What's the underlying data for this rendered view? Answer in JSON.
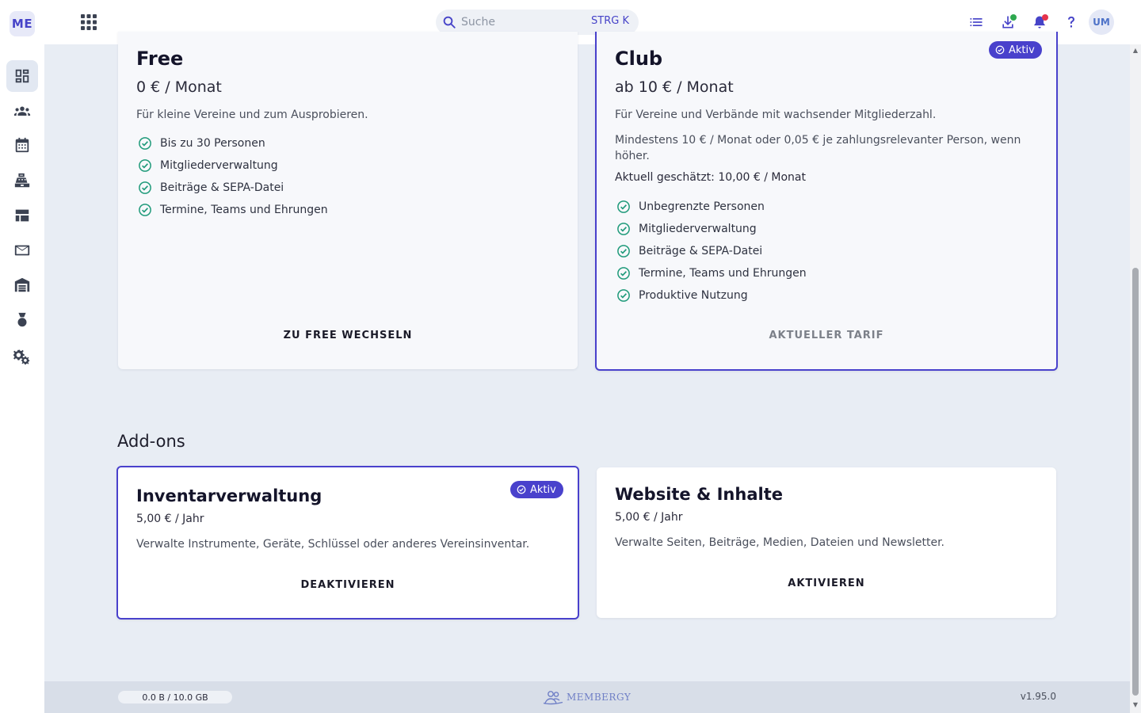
{
  "sidebar": {
    "logo": "ME",
    "items": [
      {
        "icon": "dashboard-icon",
        "active": true
      },
      {
        "icon": "people-icon"
      },
      {
        "icon": "calendar-icon"
      },
      {
        "icon": "cash-register-icon"
      },
      {
        "icon": "layout-icon"
      },
      {
        "icon": "mail-icon"
      },
      {
        "icon": "warehouse-icon"
      },
      {
        "icon": "medal-icon"
      },
      {
        "icon": "settings-icon"
      }
    ]
  },
  "header": {
    "search_placeholder": "Suche",
    "search_shortcut": "STRG K",
    "avatar_initials": "UM",
    "notification_dot_color": "#e5334b",
    "download_dot_color": "#2ea84f"
  },
  "plans": {
    "free": {
      "title": "Free",
      "price": "0 € / Monat",
      "description": "Für kleine Vereine und zum Ausprobieren.",
      "features": [
        "Bis zu 30 Personen",
        "Mitgliederverwaltung",
        "Beiträge & SEPA-Datei",
        "Termine, Teams und Ehrungen"
      ],
      "button": "ZU FREE WECHSELN"
    },
    "club": {
      "title": "Club",
      "badge": "Aktiv",
      "price": "ab 10 € / Monat",
      "description": "Für Vereine und Verbände mit wachsender Mitgliederzahl.",
      "minimum": "Mindestens 10 € / Monat oder 0,05 € je zahlungsrelevanter Person, wenn höher.",
      "estimate": "Aktuell geschätzt: 10,00 € / Monat",
      "features": [
        "Unbegrenzte Personen",
        "Mitgliederverwaltung",
        "Beiträge & SEPA-Datei",
        "Termine, Teams und Ehrungen",
        "Produktive Nutzung"
      ],
      "button": "AKTUELLER TARIF"
    }
  },
  "addons": {
    "title": "Add-ons",
    "inventory": {
      "title": "Inventarverwaltung",
      "badge": "Aktiv",
      "price": "5,00 € / Jahr",
      "description": "Verwalte Instrumente, Geräte, Schlüssel oder anderes Vereinsinventar.",
      "button": "DEAKTIVIEREN"
    },
    "website": {
      "title": "Website & Inhalte",
      "price": "5,00 € / Jahr",
      "description": "Verwalte Seiten, Beiträge, Medien, Dateien und Newsletter.",
      "button": "AKTIVIEREN"
    }
  },
  "footer": {
    "storage": "0.0 B / 10.0 GB",
    "brand": "MEMBERGY",
    "version": "v1.95.0"
  },
  "colors": {
    "accent": "#4941cc",
    "check": "#1f9a7a"
  }
}
